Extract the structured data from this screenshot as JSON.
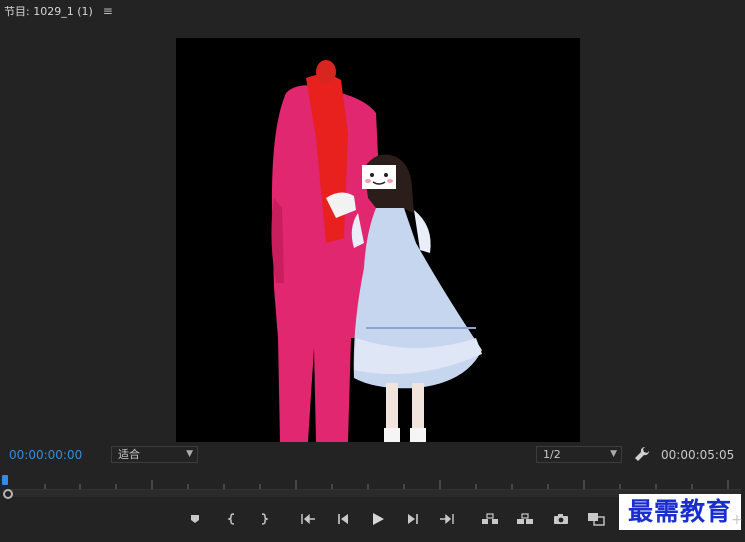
{
  "panel": {
    "title": "节目: 1029_1 (1)",
    "menu_icon": "hamburger-icon"
  },
  "timecode": {
    "current": "00:00:00:00",
    "duration": "00:00:05:05"
  },
  "fit_select": {
    "value": "适合"
  },
  "resolution_select": {
    "value": "1/2"
  },
  "colors": {
    "accent": "#2f8de4",
    "background": "#232323",
    "viewer_bg": "#000000",
    "watermark_text": "#1a2ecf"
  },
  "playback": {
    "position_fraction": 0.0
  },
  "transport_icons": [
    "add-marker-icon",
    "mark-in-icon",
    "mark-out-icon",
    "go-to-in-icon",
    "step-back-icon",
    "play-icon",
    "step-forward-icon",
    "go-to-out-icon",
    "lift-icon",
    "extract-icon",
    "export-frame-icon",
    "comparison-view-icon"
  ],
  "watermark": {
    "text": "最需教育"
  }
}
